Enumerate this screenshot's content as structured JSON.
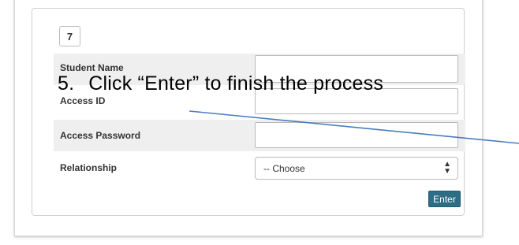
{
  "step": {
    "number": "7"
  },
  "form": {
    "fields": [
      {
        "label": "Student Name",
        "value": ""
      },
      {
        "label": "Access ID",
        "value": ""
      },
      {
        "label": "Access Password",
        "value": ""
      }
    ],
    "relationship": {
      "label": "Relationship",
      "selected": "-- Choose"
    },
    "enter_label": "Enter"
  },
  "annotation": {
    "number": "5.",
    "text": "Click “Enter” to finish the process",
    "line_color": "#4a7cc0"
  }
}
